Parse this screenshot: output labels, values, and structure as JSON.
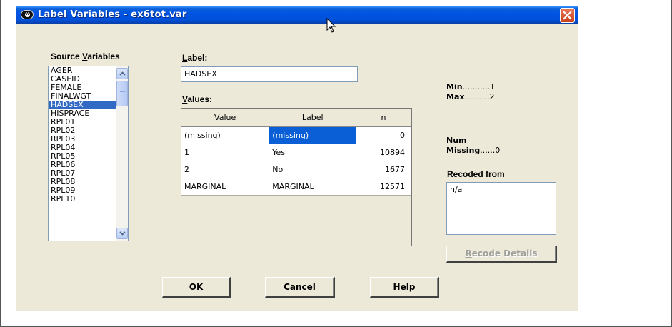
{
  "window": {
    "title": "Label Variables - ex6tot.var",
    "app_icon_letter": "W"
  },
  "source_variables": {
    "label_prefix": "Source ",
    "label_accel": "V",
    "label_rest": "ariables",
    "items": [
      "AGER",
      "CASEID",
      "FEMALE",
      "FINALWGT",
      "HADSEX",
      "HISPRACE",
      "RPL01",
      "RPL02",
      "RPL03",
      "RPL04",
      "RPL05",
      "RPL06",
      "RPL07",
      "RPL08",
      "RPL09",
      "RPL10"
    ],
    "selected": "HADSEX"
  },
  "label_field": {
    "caption_accel": "L",
    "caption_rest": "abel:",
    "value": "HADSEX"
  },
  "values_grid": {
    "caption_accel": "V",
    "caption_rest": "alues:",
    "columns": [
      "Value",
      "Label",
      "n"
    ],
    "rows": [
      {
        "value": "(missing)",
        "label": "(missing)",
        "n": "0"
      },
      {
        "value": "1",
        "label": "Yes",
        "n": "10894"
      },
      {
        "value": "2",
        "label": "No",
        "n": "1677"
      },
      {
        "value": "MARGINAL",
        "label": "MARGINAL",
        "n": "12571"
      }
    ]
  },
  "stats": {
    "min_label": "Min",
    "min_dots": "...........",
    "min_value": "1",
    "max_label": "Max",
    "max_dots": "..........",
    "max_value": "2",
    "num_label": "Num",
    "missing_label": "Missing",
    "missing_dots": "......",
    "missing_value": "0"
  },
  "recoded_from": {
    "caption": "Recoded from",
    "value": "n/a"
  },
  "buttons": {
    "recode_accel": "R",
    "recode_rest": "ecode Details",
    "ok": "OK",
    "cancel": "Cancel",
    "help_accel": "H",
    "help_rest": "elp"
  }
}
